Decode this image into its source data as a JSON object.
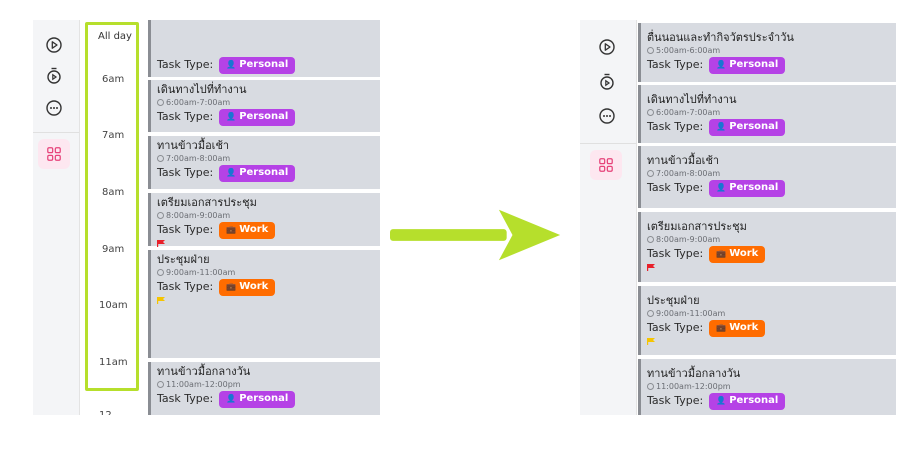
{
  "left": {
    "allday_label": "All day",
    "hours": [
      "6am",
      "7am",
      "8am",
      "9am",
      "10am",
      "11am"
    ],
    "hour_cut": "12",
    "events": [
      {
        "title": "",
        "time": "",
        "type_label": "Task Type:",
        "tag": "Personal",
        "tag_kind": "personal",
        "flag": ""
      },
      {
        "title": "เดินทางไปที่ทำงาน",
        "time": "6:00am-7:00am",
        "type_label": "Task Type:",
        "tag": "Personal",
        "tag_kind": "personal",
        "flag": ""
      },
      {
        "title": "ทานข้าวมื้อเช้า",
        "time": "7:00am-8:00am",
        "type_label": "Task Type:",
        "tag": "Personal",
        "tag_kind": "personal",
        "flag": ""
      },
      {
        "title": "เตรียมเอกสารประชุม",
        "time": "8:00am-9:00am",
        "type_label": "Task Type:",
        "tag": "Work",
        "tag_kind": "work",
        "flag": "red"
      },
      {
        "title": "ประชุมฝ่าย",
        "time": "9:00am-11:00am",
        "type_label": "Task Type:",
        "tag": "Work",
        "tag_kind": "work",
        "flag": "yellow"
      },
      {
        "title": "ทานข้าวมื้อกลางวัน",
        "time": "11:00am-12:00pm",
        "type_label": "Task Type:",
        "tag": "Personal",
        "tag_kind": "personal",
        "flag": ""
      }
    ]
  },
  "right": {
    "events": [
      {
        "title": "ตื่นนอนและทำกิจวัตรประจำวัน",
        "time": "5:00am-6:00am",
        "type_label": "Task Type:",
        "tag": "Personal",
        "tag_kind": "personal",
        "flag": ""
      },
      {
        "title": "เดินทางไปที่ทำงาน",
        "time": "6:00am-7:00am",
        "type_label": "Task Type:",
        "tag": "Personal",
        "tag_kind": "personal",
        "flag": ""
      },
      {
        "title": "ทานข้าวมื้อเช้า",
        "time": "7:00am-8:00am",
        "type_label": "Task Type:",
        "tag": "Personal",
        "tag_kind": "personal",
        "flag": ""
      },
      {
        "title": "เตรียมเอกสารประชุม",
        "time": "8:00am-9:00am",
        "type_label": "Task Type:",
        "tag": "Work",
        "tag_kind": "work",
        "flag": "red"
      },
      {
        "title": "ประชุมฝ่าย",
        "time": "9:00am-11:00am",
        "type_label": "Task Type:",
        "tag": "Work",
        "tag_kind": "work",
        "flag": "yellow"
      },
      {
        "title": "ทานข้าวมื้อกลางวัน",
        "time": "11:00am-12:00pm",
        "type_label": "Task Type:",
        "tag": "Personal",
        "tag_kind": "personal",
        "flag": ""
      }
    ]
  },
  "icons": {
    "rail": [
      "play-icon",
      "timer-icon",
      "more-icon",
      "grid-icon"
    ],
    "tag_personal": "person-icon",
    "tag_work": "briefcase-icon",
    "arrow": "right-arrow-icon"
  },
  "colors": {
    "personal": "#b542e6",
    "work": "#ff6c00",
    "highlight": "#b6df2c",
    "arrow": "#b6df2c",
    "flag_red": "#e8202a",
    "flag_yellow": "#f5c400"
  }
}
